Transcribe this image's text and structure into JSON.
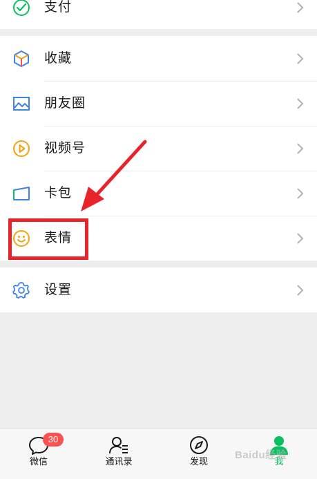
{
  "menu": {
    "pay": {
      "label": "支付",
      "icon": "pay-icon"
    },
    "favorites": {
      "label": "收藏",
      "icon": "favorites-cube-icon"
    },
    "moments": {
      "label": "朋友圈",
      "icon": "moments-image-icon"
    },
    "channels": {
      "label": "视频号",
      "icon": "channels-play-icon"
    },
    "cards": {
      "label": "卡包",
      "icon": "card-wallet-icon"
    },
    "stickers": {
      "label": "表情",
      "icon": "smiley-icon"
    },
    "settings": {
      "label": "设置",
      "icon": "gear-icon"
    }
  },
  "tabbar": {
    "chats": {
      "label": "微信",
      "badge": "30",
      "icon": "chat-bubble-icon"
    },
    "contacts": {
      "label": "通讯录",
      "icon": "contacts-icon"
    },
    "discover": {
      "label": "发现",
      "icon": "compass-icon"
    },
    "me": {
      "label": "我",
      "icon": "person-icon",
      "active": true
    }
  },
  "colors": {
    "background": "#ededed",
    "accent_green": "#07c160",
    "annotation_red": "#e8242a",
    "badge_red": "#fa5151"
  },
  "watermark": "Baidu经验"
}
